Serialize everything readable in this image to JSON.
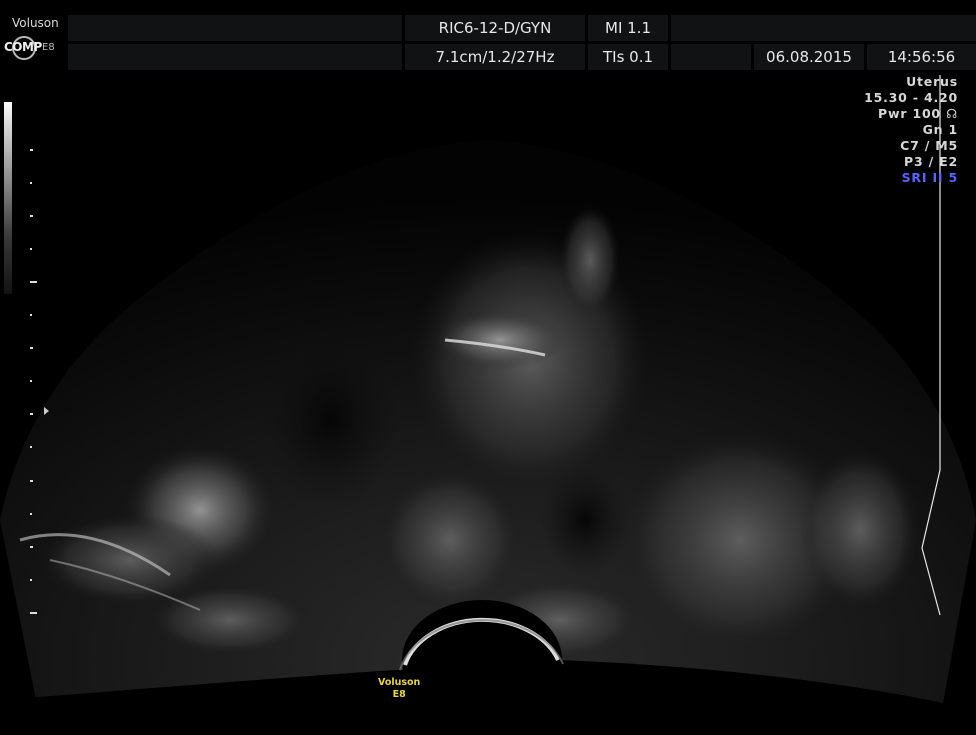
{
  "header": {
    "brand": "Voluson",
    "logo_text": "COMP",
    "logo_model": "E8",
    "probe": "RIC6-12-D/GYN",
    "mi": "MI  1.1",
    "depth": "7.1cm/1.2/27Hz",
    "tis": "TIs  0.1",
    "date": "06.08.2015",
    "time": "14:56:56"
  },
  "params": {
    "preset": "Uterus",
    "freq": "15.30 - 4.20",
    "power": "Pwr 100 ☊",
    "gain": "Gn  1",
    "c_m": "C7 / M5",
    "p_e": "P3 / E2",
    "sri": "SRI II 5"
  },
  "footer": {
    "brand": "Voluson",
    "model": "E8"
  },
  "colors": {
    "sri_accent": "#5b63ff",
    "footer_text": "#e8d44a"
  }
}
